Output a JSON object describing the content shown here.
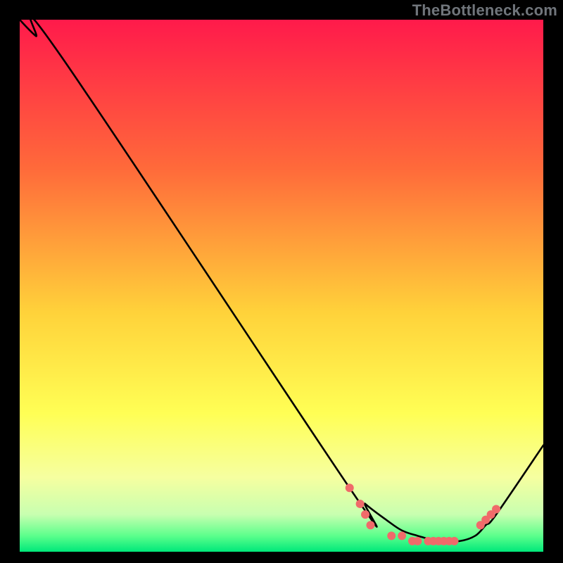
{
  "watermark": "TheBottleneck.com",
  "chart_data": {
    "type": "line",
    "title": "",
    "xlabel": "",
    "ylabel": "",
    "xlim": [
      0,
      100
    ],
    "ylim": [
      0,
      100
    ],
    "grid": false,
    "legend": false,
    "gradient_stops": [
      {
        "offset": 0,
        "color": "#ff1a4b"
      },
      {
        "offset": 28,
        "color": "#ff6a3a"
      },
      {
        "offset": 55,
        "color": "#ffd23a"
      },
      {
        "offset": 74,
        "color": "#ffff55"
      },
      {
        "offset": 86,
        "color": "#f6ffa0"
      },
      {
        "offset": 93,
        "color": "#c8ffb0"
      },
      {
        "offset": 97,
        "color": "#5cff8c"
      },
      {
        "offset": 100,
        "color": "#00e87a"
      }
    ],
    "series": [
      {
        "name": "curve",
        "color": "#000000",
        "x": [
          0,
          3,
          8,
          63,
          66,
          70,
          73,
          76,
          80,
          84,
          87,
          89,
          91,
          100
        ],
        "y": [
          100,
          97,
          93,
          12,
          9,
          6,
          4,
          3,
          2,
          2,
          3,
          5,
          7,
          20
        ]
      }
    ],
    "markers": {
      "color": "#f06a6a",
      "radius": 6,
      "points": [
        {
          "x": 63,
          "y": 12
        },
        {
          "x": 65,
          "y": 9
        },
        {
          "x": 66,
          "y": 7
        },
        {
          "x": 67,
          "y": 5
        },
        {
          "x": 71,
          "y": 3
        },
        {
          "x": 73,
          "y": 3
        },
        {
          "x": 75,
          "y": 2
        },
        {
          "x": 76,
          "y": 2
        },
        {
          "x": 78,
          "y": 2
        },
        {
          "x": 79,
          "y": 2
        },
        {
          "x": 80,
          "y": 2
        },
        {
          "x": 81,
          "y": 2
        },
        {
          "x": 82,
          "y": 2
        },
        {
          "x": 83,
          "y": 2
        },
        {
          "x": 88,
          "y": 5
        },
        {
          "x": 89,
          "y": 6
        },
        {
          "x": 90,
          "y": 7
        },
        {
          "x": 91,
          "y": 8
        }
      ]
    }
  }
}
